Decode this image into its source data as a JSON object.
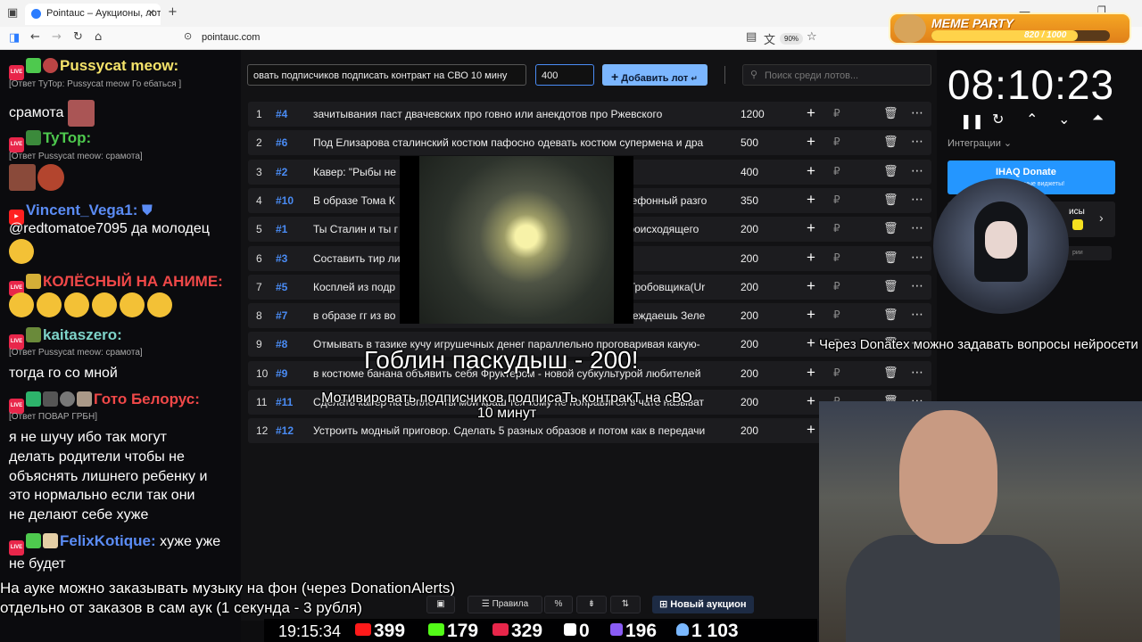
{
  "browser": {
    "tab_title": "Pointauc – Аукционы, лотерея",
    "url": "pointauc.com",
    "zoom": "90%"
  },
  "meme_party": {
    "title": "MEME PARTY",
    "score": "820 / 1000",
    "progress": 0.82
  },
  "chat": {
    "lines": [
      {
        "user": "Pussycat meow:",
        "color": "#f5e36a"
      },
      {
        "reply": "[Ответ TyTop: Pussycat meow Го ебаться ]"
      },
      {
        "text": "срамота"
      },
      {
        "user": "TyTop:",
        "color": "#4ec94e"
      },
      {
        "reply": "[Ответ Pussycat meow: срамота]"
      },
      {
        "user": "Vincent_Vega1:",
        "color": "#5b8cf5"
      },
      {
        "text": "@redtomatoe7095 да молодец"
      },
      {
        "user": "КОЛЁСНЫЙ НА АНИМЕ:",
        "color": "#f04848"
      },
      {
        "user": "kaitaszero:",
        "color": "#7ed3c9"
      },
      {
        "reply": "[Ответ Pussycat meow: срамота]"
      },
      {
        "text": "тогда го со мной"
      },
      {
        "user": "Гото Белорус:",
        "color": "#f04848"
      },
      {
        "reply": "[Ответ ПОВАР ГРБН]"
      },
      {
        "text1": "я не шучу ибо так могут",
        "text2": "делать родители чтобы не",
        "text3": "объяснять лишнего ребенку и",
        "text4": "это нормально если так они",
        "text5": "не делают себе хуже"
      },
      {
        "user": "FelixKotique:",
        "color": "#5b8cf5",
        "msg": "хуже уже"
      },
      {
        "text": "не будет"
      }
    ]
  },
  "auction": {
    "lot_name_value": "овать подписчиков подписать контракт на СВО 10 мину",
    "amount_value": "400",
    "add_button": "Добавить лот",
    "search_placeholder": "Поиск среди лотов...",
    "rows": [
      {
        "n": "1",
        "tag": "#4",
        "name": "зачитывания паст двачевских про говно или анекдотов про Ржевского",
        "amount": "1200"
      },
      {
        "n": "2",
        "tag": "#6",
        "name": "Под Елизарова сталинский костюм пафосно одевать костюм супермена и дра",
        "amount": "500"
      },
      {
        "n": "3",
        "tag": "#2",
        "name": "Кавер: \"Рыбы не",
        "amount": "400"
      },
      {
        "n": "4",
        "tag": "#10",
        "name": "В образе Тома К",
        "tail": "телефонный разго",
        "amount": "350"
      },
      {
        "n": "5",
        "tag": "#1",
        "name": "Ты Сталин и ты г",
        "tail": "т происходящего",
        "amount": "200"
      },
      {
        "n": "6",
        "tag": "#3",
        "name": "Составить тир ли",
        "amount": "200"
      },
      {
        "n": "7",
        "tag": "#5",
        "name": "Косплей из подр",
        "tail": "ра Гробовщика(Ur",
        "amount": "200"
      },
      {
        "n": "8",
        "tag": "#7",
        "name": "в образе гг из во",
        "tail": "побеждаешь Зеле",
        "amount": "200"
      },
      {
        "n": "9",
        "tag": "#8",
        "name": "Отмывать в тазике кучу игрушечных денег параллельно проговаривая какую-",
        "amount": "200"
      },
      {
        "n": "10",
        "tag": "#9",
        "name": "в костюме банана объявить себя Фруктером - новой субкультурой любителей",
        "amount": "200"
      },
      {
        "n": "11",
        "tag": "#11",
        "name": "Сделать кавер на вопле - ты мой краш тех кому не понравится в чате называт",
        "amount": "200"
      },
      {
        "n": "12",
        "tag": "#12",
        "name": "Устроить модный приговор. Сделать 5 разных образов и потом как в передачи",
        "amount": "200"
      }
    ],
    "currency": "₽",
    "toolbar": {
      "rules": "Правила",
      "percent": "%",
      "new_auction": "Новый аукцион"
    }
  },
  "right": {
    "clock": "08:10:23",
    "integrations": "Интеграции",
    "donate_title": "IHAQ Donate",
    "donate_sub": "уникальные виджеты!",
    "side_label": "исы",
    "side_label2": "рии"
  },
  "overlays": {
    "goblin": "Гоблин паскудыш - 200!",
    "motivation": "Мотивировать подписчиков подписаТь контракТ на сВО 10 минут",
    "donatex": "Через Donatex можно задавать вопросы нейросети",
    "music1": "На ауке можно заказывать музыку на фон (через DonationAlerts)",
    "music2": "отдельно от заказов в сам аук (1 секунда - 3 рубля)"
  },
  "stats": {
    "time": "19:15:34",
    "youtube": "399",
    "kick": "179",
    "live": "329",
    "rumble": "0",
    "other": "196",
    "viewers": "1 103"
  }
}
